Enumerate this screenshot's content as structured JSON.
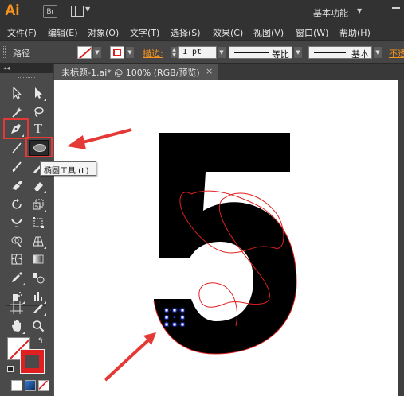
{
  "app": {
    "logo": "Ai",
    "bridge_label": "Br",
    "workspace": "基本功能"
  },
  "menu": [
    "文件(F)",
    "编辑(E)",
    "对象(O)",
    "文字(T)",
    "选择(S)",
    "效果(C)",
    "视图(V)",
    "窗口(W)",
    "帮助(H)"
  ],
  "control": {
    "selection_label": "路径",
    "stroke_label": "描边:",
    "stroke_weight": "1 pt",
    "profile_label": "等比",
    "brush_label": "基本",
    "opacity_label": "不透"
  },
  "tabs": {
    "tools_collapse": "◂◂",
    "document_tab": "未标题-1.ai* @ 100% (RGB/预览)",
    "close": "×"
  },
  "tools": {
    "type_tool_glyph": "T",
    "tooltip": "椭圆工具 (L)"
  },
  "canvas": {
    "glyph": "5"
  },
  "colors": {
    "accent": "#f7941d",
    "highlight": "#e53935",
    "stroke": "#e02020",
    "selection_handle": "#1f33c9"
  }
}
